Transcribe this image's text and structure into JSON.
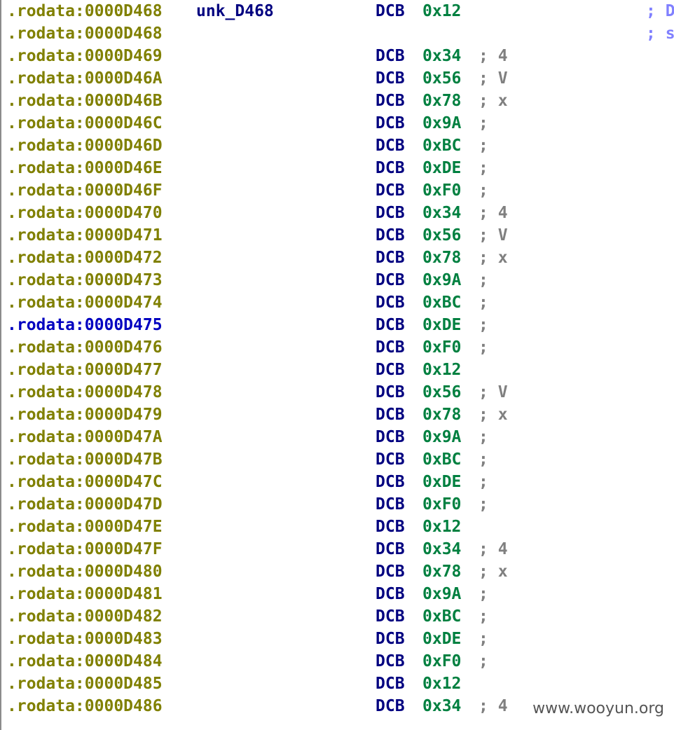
{
  "colors": {
    "address": "#808000",
    "address_selected": "#0000c0",
    "label": "#000080",
    "mnemonic": "#000080",
    "value": "#008040",
    "comment": "#808080",
    "right_comment": "#8080ff",
    "watermark": "#555555"
  },
  "rows": [
    {
      "address": ".rodata:0000D468",
      "label": "unk_D468",
      "mnemonic": "DCB",
      "value": "0x12",
      "comment": "",
      "right_comment": "; D"
    },
    {
      "address": ".rodata:0000D468",
      "label": "",
      "mnemonic": "",
      "value": "",
      "comment": "",
      "right_comment": "; s"
    },
    {
      "address": ".rodata:0000D469",
      "label": "",
      "mnemonic": "DCB",
      "value": "0x34",
      "comment": "; 4",
      "right_comment": ""
    },
    {
      "address": ".rodata:0000D46A",
      "label": "",
      "mnemonic": "DCB",
      "value": "0x56",
      "comment": "; V",
      "right_comment": ""
    },
    {
      "address": ".rodata:0000D46B",
      "label": "",
      "mnemonic": "DCB",
      "value": "0x78",
      "comment": "; x",
      "right_comment": ""
    },
    {
      "address": ".rodata:0000D46C",
      "label": "",
      "mnemonic": "DCB",
      "value": "0x9A",
      "comment": ";",
      "right_comment": ""
    },
    {
      "address": ".rodata:0000D46D",
      "label": "",
      "mnemonic": "DCB",
      "value": "0xBC",
      "comment": ";",
      "right_comment": ""
    },
    {
      "address": ".rodata:0000D46E",
      "label": "",
      "mnemonic": "DCB",
      "value": "0xDE",
      "comment": ";",
      "right_comment": ""
    },
    {
      "address": ".rodata:0000D46F",
      "label": "",
      "mnemonic": "DCB",
      "value": "0xF0",
      "comment": ";",
      "right_comment": ""
    },
    {
      "address": ".rodata:0000D470",
      "label": "",
      "mnemonic": "DCB",
      "value": "0x34",
      "comment": "; 4",
      "right_comment": ""
    },
    {
      "address": ".rodata:0000D471",
      "label": "",
      "mnemonic": "DCB",
      "value": "0x56",
      "comment": "; V",
      "right_comment": ""
    },
    {
      "address": ".rodata:0000D472",
      "label": "",
      "mnemonic": "DCB",
      "value": "0x78",
      "comment": "; x",
      "right_comment": ""
    },
    {
      "address": ".rodata:0000D473",
      "label": "",
      "mnemonic": "DCB",
      "value": "0x9A",
      "comment": ";",
      "right_comment": ""
    },
    {
      "address": ".rodata:0000D474",
      "label": "",
      "mnemonic": "DCB",
      "value": "0xBC",
      "comment": ";",
      "right_comment": ""
    },
    {
      "address": ".rodata:0000D475",
      "label": "",
      "mnemonic": "DCB",
      "value": "0xDE",
      "comment": ";",
      "right_comment": "",
      "selected": true
    },
    {
      "address": ".rodata:0000D476",
      "label": "",
      "mnemonic": "DCB",
      "value": "0xF0",
      "comment": ";",
      "right_comment": ""
    },
    {
      "address": ".rodata:0000D477",
      "label": "",
      "mnemonic": "DCB",
      "value": "0x12",
      "comment": "",
      "right_comment": ""
    },
    {
      "address": ".rodata:0000D478",
      "label": "",
      "mnemonic": "DCB",
      "value": "0x56",
      "comment": "; V",
      "right_comment": ""
    },
    {
      "address": ".rodata:0000D479",
      "label": "",
      "mnemonic": "DCB",
      "value": "0x78",
      "comment": "; x",
      "right_comment": ""
    },
    {
      "address": ".rodata:0000D47A",
      "label": "",
      "mnemonic": "DCB",
      "value": "0x9A",
      "comment": ";",
      "right_comment": ""
    },
    {
      "address": ".rodata:0000D47B",
      "label": "",
      "mnemonic": "DCB",
      "value": "0xBC",
      "comment": ";",
      "right_comment": ""
    },
    {
      "address": ".rodata:0000D47C",
      "label": "",
      "mnemonic": "DCB",
      "value": "0xDE",
      "comment": ";",
      "right_comment": ""
    },
    {
      "address": ".rodata:0000D47D",
      "label": "",
      "mnemonic": "DCB",
      "value": "0xF0",
      "comment": ";",
      "right_comment": ""
    },
    {
      "address": ".rodata:0000D47E",
      "label": "",
      "mnemonic": "DCB",
      "value": "0x12",
      "comment": "",
      "right_comment": ""
    },
    {
      "address": ".rodata:0000D47F",
      "label": "",
      "mnemonic": "DCB",
      "value": "0x34",
      "comment": "; 4",
      "right_comment": ""
    },
    {
      "address": ".rodata:0000D480",
      "label": "",
      "mnemonic": "DCB",
      "value": "0x78",
      "comment": "; x",
      "right_comment": ""
    },
    {
      "address": ".rodata:0000D481",
      "label": "",
      "mnemonic": "DCB",
      "value": "0x9A",
      "comment": ";",
      "right_comment": ""
    },
    {
      "address": ".rodata:0000D482",
      "label": "",
      "mnemonic": "DCB",
      "value": "0xBC",
      "comment": ";",
      "right_comment": ""
    },
    {
      "address": ".rodata:0000D483",
      "label": "",
      "mnemonic": "DCB",
      "value": "0xDE",
      "comment": ";",
      "right_comment": ""
    },
    {
      "address": ".rodata:0000D484",
      "label": "",
      "mnemonic": "DCB",
      "value": "0xF0",
      "comment": ";",
      "right_comment": ""
    },
    {
      "address": ".rodata:0000D485",
      "label": "",
      "mnemonic": "DCB",
      "value": "0x12",
      "comment": "",
      "right_comment": ""
    },
    {
      "address": ".rodata:0000D486",
      "label": "",
      "mnemonic": "DCB",
      "value": "0x34",
      "comment": "; 4",
      "right_comment": ""
    }
  ],
  "watermark": "www.wooyun.org"
}
